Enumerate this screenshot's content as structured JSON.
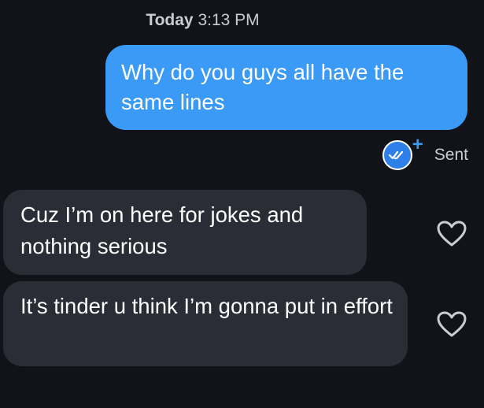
{
  "header": {
    "day": "Today",
    "time": "3:13 PM"
  },
  "messages": [
    {
      "direction": "outgoing",
      "text": "Why do you guys all have the same lines"
    },
    {
      "direction": "incoming",
      "text": "Cuz I’m on here for jokes and nothing serious",
      "reaction": "heart-outline-icon"
    },
    {
      "direction": "incoming",
      "text": "It’s tinder u think I’m gonna put in effort",
      "reaction": "heart-outline-icon"
    }
  ],
  "status": {
    "label": "Sent",
    "read_icon": "double-check-icon",
    "plus": "+"
  },
  "colors": {
    "background": "#111318",
    "outgoing_bubble": "#3a9af5",
    "incoming_bubble": "#2a2d35",
    "accent": "#2f7fe8"
  }
}
